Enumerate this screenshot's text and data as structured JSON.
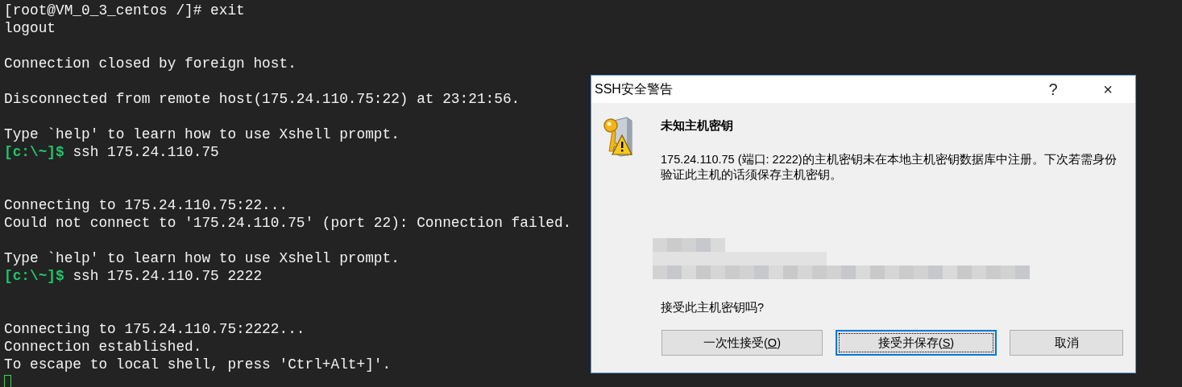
{
  "terminal": {
    "lines": [
      {
        "kind": "text",
        "text": "[root@VM_0_3_centos /]# exit"
      },
      {
        "kind": "text",
        "text": "logout"
      },
      {
        "kind": "blank"
      },
      {
        "kind": "text",
        "text": "Connection closed by foreign host."
      },
      {
        "kind": "blank"
      },
      {
        "kind": "text",
        "text": "Disconnected from remote host(175.24.110.75:22) at 23:21:56."
      },
      {
        "kind": "blank"
      },
      {
        "kind": "text",
        "text": "Type `help' to learn how to use Xshell prompt."
      },
      {
        "kind": "prompt",
        "prompt": "[c:\\~]$",
        "text": "ssh 175.24.110.75"
      },
      {
        "kind": "blank"
      },
      {
        "kind": "blank"
      },
      {
        "kind": "text",
        "text": "Connecting to 175.24.110.75:22..."
      },
      {
        "kind": "text",
        "text": "Could not connect to '175.24.110.75' (port 22): Connection failed."
      },
      {
        "kind": "blank"
      },
      {
        "kind": "text",
        "text": "Type `help' to learn how to use Xshell prompt."
      },
      {
        "kind": "prompt",
        "prompt": "[c:\\~]$",
        "text": "ssh 175.24.110.75 2222"
      },
      {
        "kind": "blank"
      },
      {
        "kind": "blank"
      },
      {
        "kind": "text",
        "text": "Connecting to 175.24.110.75:2222..."
      },
      {
        "kind": "text",
        "text": "Connection established."
      },
      {
        "kind": "text",
        "text": "To escape to local shell, press 'Ctrl+Alt+]'."
      },
      {
        "kind": "cursor"
      }
    ]
  },
  "dialog": {
    "title": "SSH安全警告",
    "title_buttons": [
      "?",
      "×"
    ],
    "heading": "未知主机密钥",
    "message": "175.24.110.75 (端口: 2222)的主机密钥未在本地主机密钥数据库中注册。下次若需身份验证此主机的话须保存主机密钥。",
    "question": "接受此主机密钥吗?",
    "buttons": [
      {
        "before": "一次性接受(",
        "accesskey": "O",
        "after": ")",
        "focused": false
      },
      {
        "before": "接受并保存(",
        "accesskey": "S",
        "after": ")",
        "focused": true
      },
      {
        "before": "取消",
        "focused": false
      }
    ]
  }
}
